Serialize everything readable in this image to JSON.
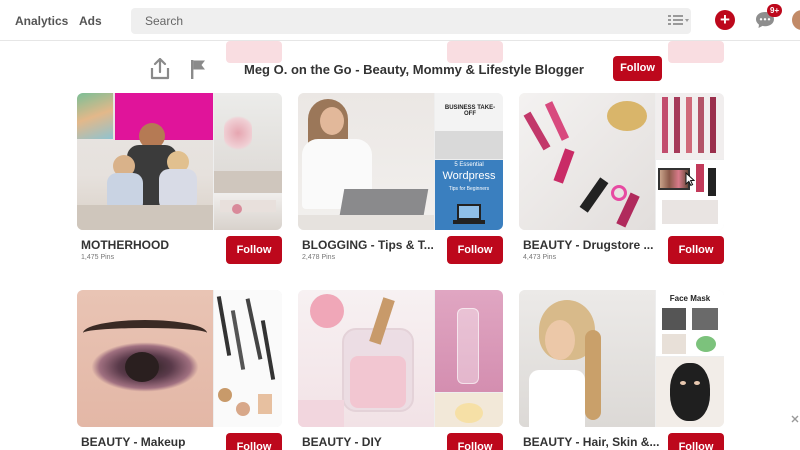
{
  "nav": {
    "analytics": "Analytics",
    "ads": "Ads"
  },
  "search": {
    "placeholder": "Search",
    "value": ""
  },
  "toolbar": {
    "create_label": "+",
    "notification_count": "9+"
  },
  "profile": {
    "name": "Meg O. on the Go - Beauty, Mommy & Lifestyle Blogger",
    "follow_label": "Follow"
  },
  "boards": [
    {
      "title": "MOTHERHOOD",
      "pins": "1,475 Pins",
      "follow_label": "Follow"
    },
    {
      "title": "BLOGGING - Tips & T...",
      "pins": "2,478 Pins",
      "follow_label": "Follow"
    },
    {
      "title": "BEAUTY - Drugstore ...",
      "pins": "4,473 Pins",
      "follow_label": "Follow"
    },
    {
      "title": "BEAUTY - Makeup",
      "pins": "",
      "follow_label": "Follow"
    },
    {
      "title": "BEAUTY - DIY",
      "pins": "",
      "follow_label": "Follow"
    },
    {
      "title": "BEAUTY - Hair, Skin &...",
      "pins": "",
      "follow_label": "Follow"
    }
  ],
  "thumb_texts": {
    "business_takeoff": "BUSINESS TAKE-OFF",
    "essential": "5 Essential",
    "wordpress": "Wordpress",
    "tips": "Tips for Beginners",
    "face_mask": "Face Mask"
  },
  "colors": {
    "brand_red": "#bd081c",
    "ghost_pink": "#f9dde1"
  }
}
